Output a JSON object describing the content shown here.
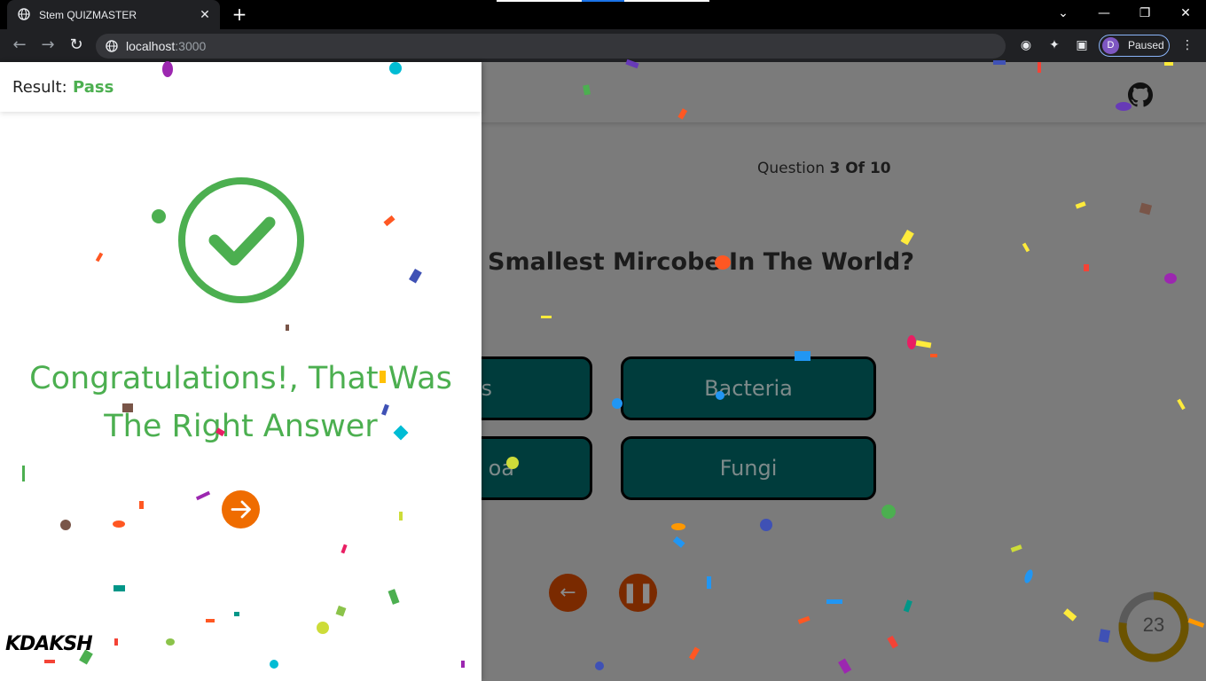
{
  "browser": {
    "tab_title": "Stem QUIZMASTER",
    "url_host": "localhost",
    "url_port": ":3000",
    "profile_initial": "D",
    "profile_status": "Paused"
  },
  "quiz": {
    "question_prefix": "Question",
    "question_number": "3 Of 10",
    "question_text": "Smallest Mircobe In The World?",
    "options": {
      "top_left": "s",
      "top_right": "Bacteria",
      "bottom_left": "oa",
      "bottom_right": "Fungi"
    },
    "timer_value": "23",
    "timer_fraction_remaining": 0.77
  },
  "result": {
    "label": "Result:",
    "value": "Pass",
    "message": "Congratulations!, That Was The Right Answer"
  },
  "branding": {
    "logo_text": "KDAKSH"
  },
  "colors": {
    "pass_green": "#4caf50",
    "accent_orange": "#ef6c00",
    "option_bg": "#003c3c",
    "timer_track": "#5a5a5a",
    "timer_fill": "#6b5300"
  },
  "icons": [
    "globe-icon",
    "close-icon",
    "plus-icon",
    "back-arrow-icon",
    "forward-arrow-icon",
    "reload-icon",
    "github-icon",
    "check-circle-icon",
    "arrow-right-icon",
    "pause-icon",
    "extensions-icon"
  ]
}
